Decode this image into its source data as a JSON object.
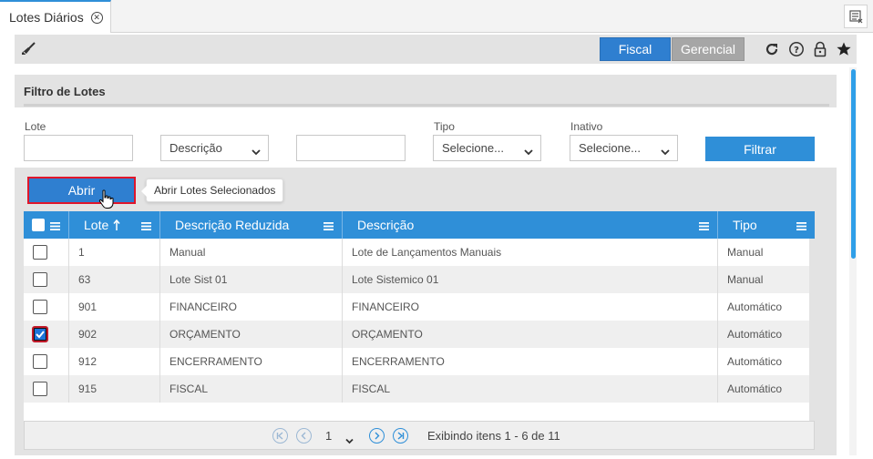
{
  "tabs": [
    {
      "label": "Lotes Diários"
    }
  ],
  "toolbar": {
    "fiscal_label": "Fiscal",
    "gerencial_label": "Gerencial"
  },
  "colors": {
    "accent": "#2f8fd8",
    "header_blue": "#2f7fd0",
    "scrollbar": "#2f9fe8",
    "highlight_red": "#e0162b"
  },
  "icons": [
    "broom-icon",
    "refresh-icon",
    "help-icon",
    "lock-icon",
    "star-icon",
    "tab-close-icon",
    "tab-list-icon",
    "chevron-down-icon",
    "hamburger-menu-icon",
    "sort-asc-icon",
    "pointer-cursor-icon",
    "first-page-icon",
    "previous-page-icon",
    "next-page-icon",
    "last-page-icon"
  ],
  "filter": {
    "title": "Filtro de Lotes",
    "lote_label": "Lote",
    "lote_value": "",
    "campo_selected": "Descrição",
    "texto_value": "",
    "tipo_label": "Tipo",
    "tipo_selected": "Selecione...",
    "inativo_label": "Inativo",
    "inativo_selected": "Selecione...",
    "filtrar_label": "Filtrar"
  },
  "actions": {
    "abrir_label": "Abrir",
    "abrir_tooltip": "Abrir Lotes Selecionados"
  },
  "grid": {
    "columns": [
      "Lote",
      "Descrição Reduzida",
      "Descrição",
      "Tipo"
    ],
    "rows": [
      {
        "checked": false,
        "lote": "1",
        "desc_reduzida": "Manual",
        "descricao": "Lote de Lançamentos Manuais",
        "tipo": "Manual"
      },
      {
        "checked": false,
        "lote": "63",
        "desc_reduzida": "Lote Sist 01",
        "descricao": "Lote Sistemico 01",
        "tipo": "Manual"
      },
      {
        "checked": false,
        "lote": "901",
        "desc_reduzida": "FINANCEIRO",
        "descricao": "FINANCEIRO",
        "tipo": "Automático"
      },
      {
        "checked": true,
        "lote": "902",
        "desc_reduzida": "ORÇAMENTO",
        "descricao": "ORÇAMENTO",
        "tipo": "Automático"
      },
      {
        "checked": false,
        "lote": "912",
        "desc_reduzida": "ENCERRAMENTO",
        "descricao": "ENCERRAMENTO",
        "tipo": "Automático"
      },
      {
        "checked": false,
        "lote": "915",
        "desc_reduzida": "FISCAL",
        "descricao": "FISCAL",
        "tipo": "Automático"
      }
    ]
  },
  "pager": {
    "page": "1",
    "info": "Exibindo itens 1 - 6 de 11"
  }
}
